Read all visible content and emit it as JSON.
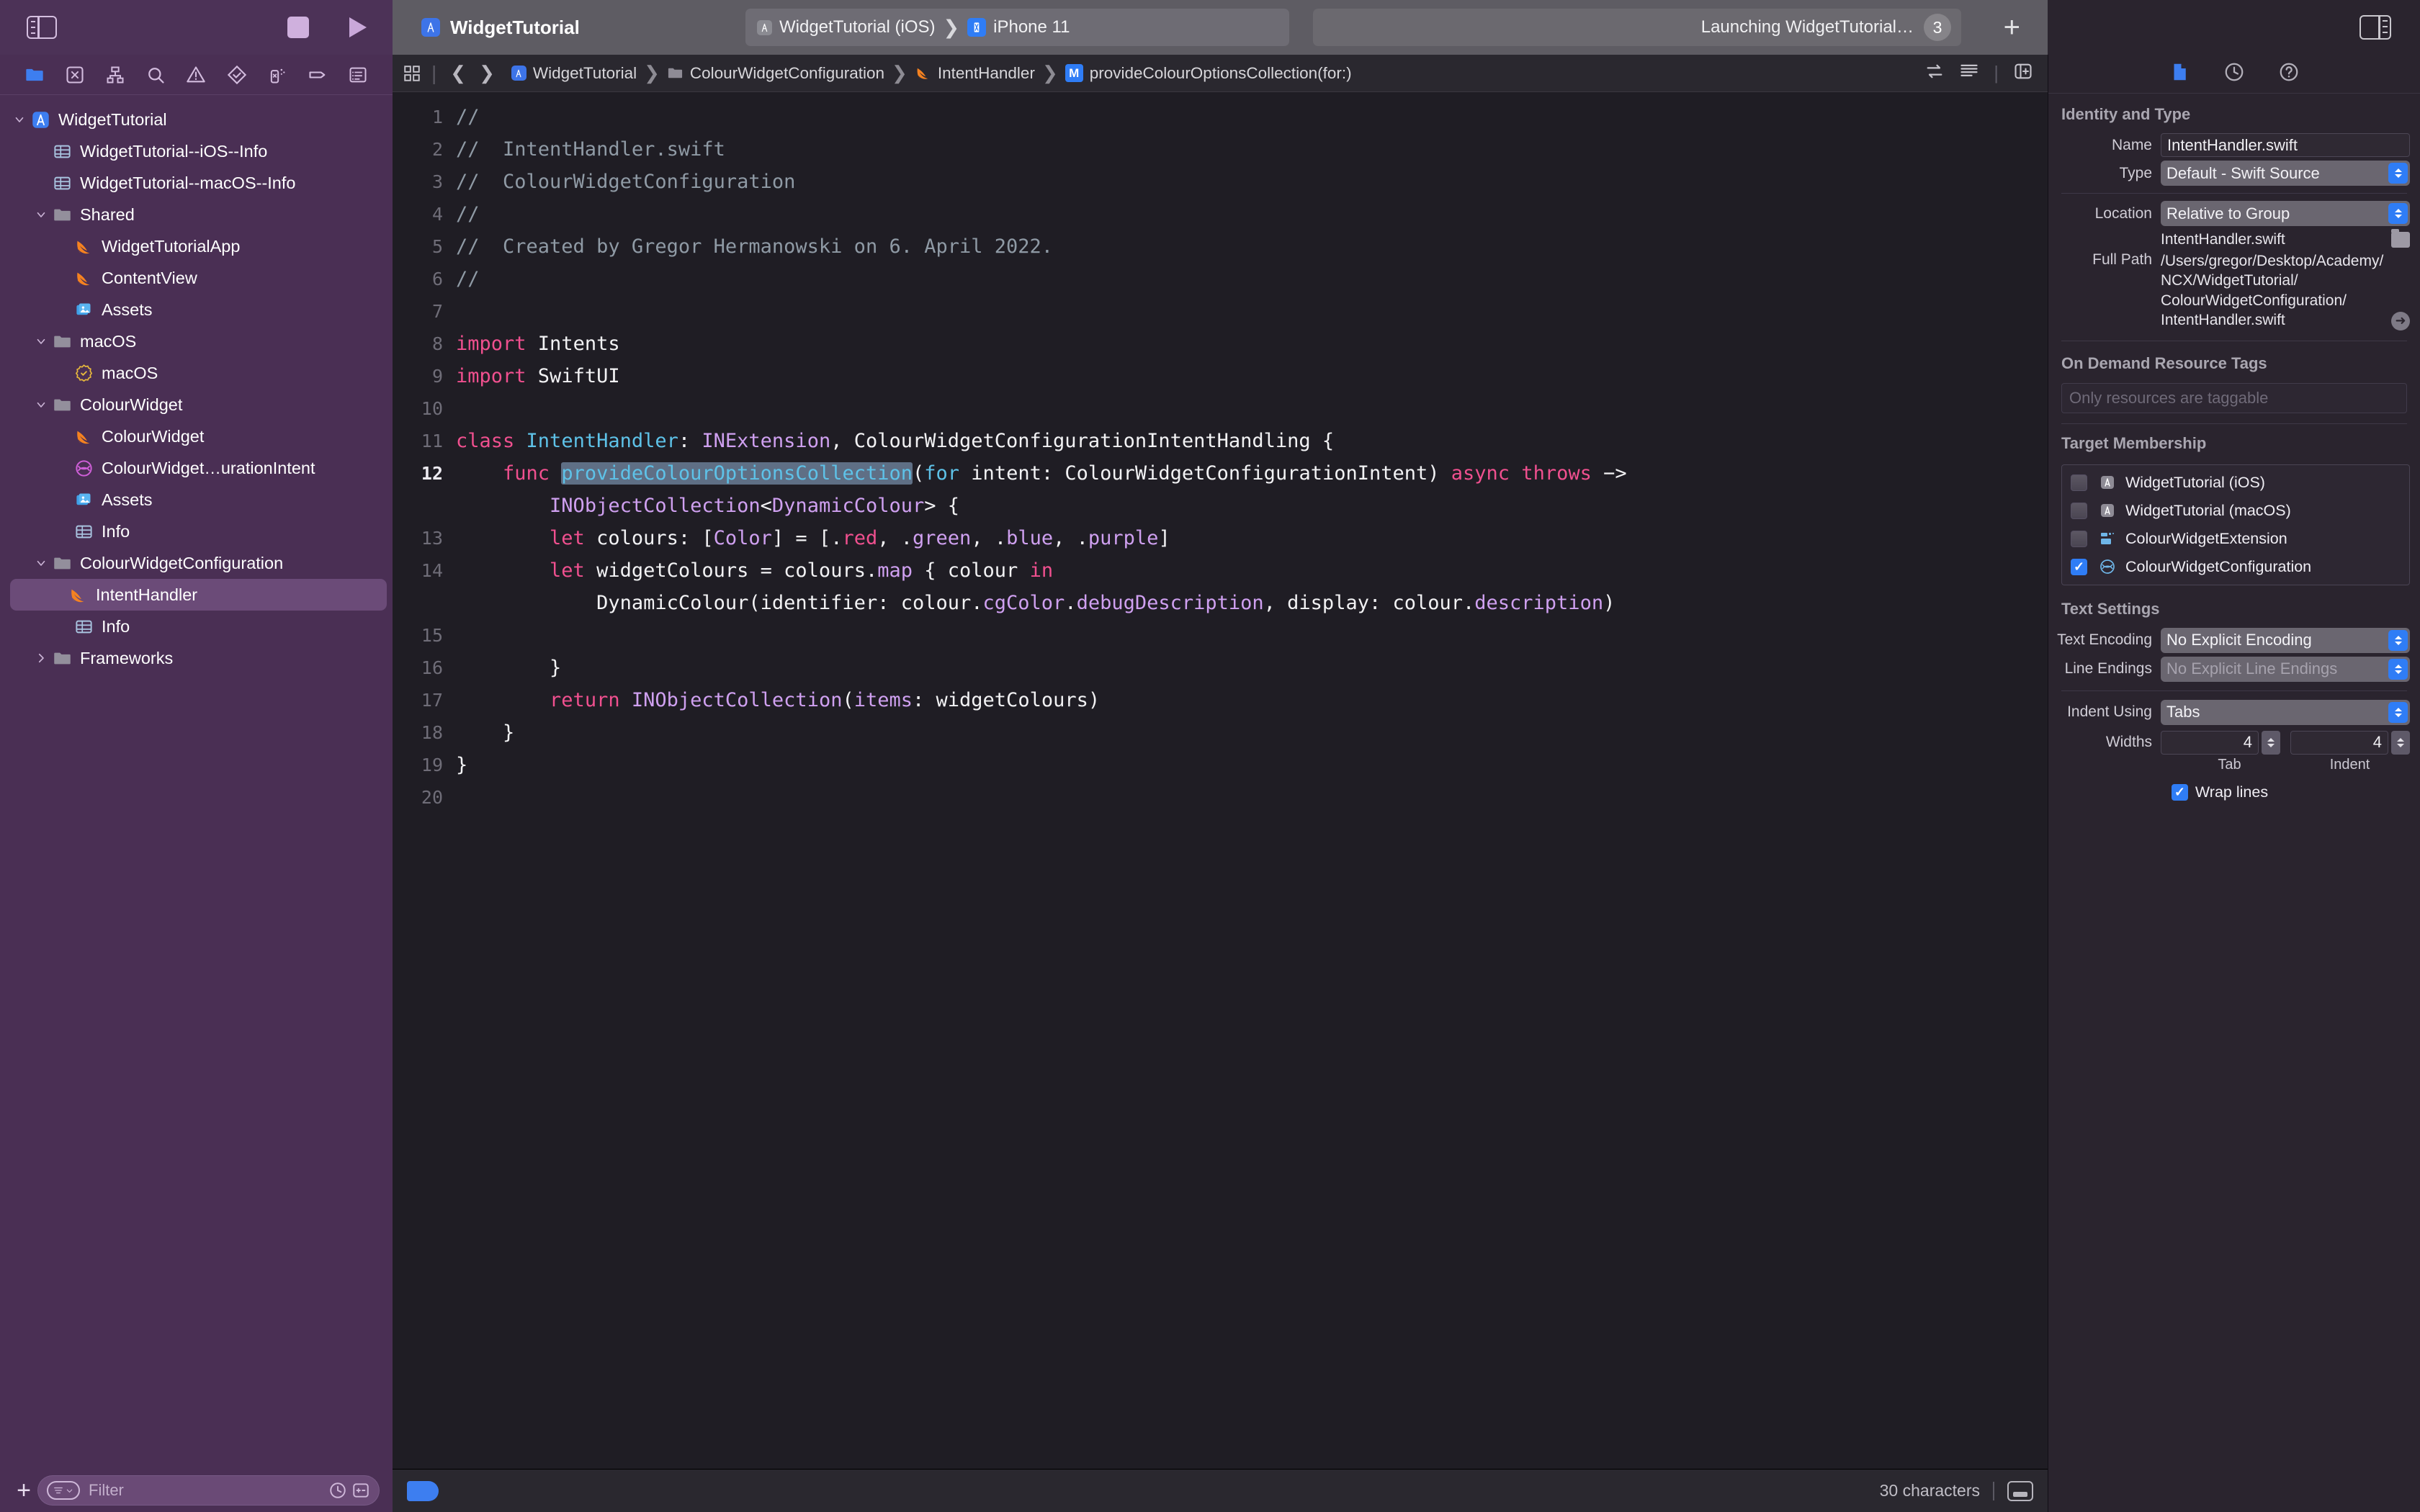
{
  "toolbar": {
    "project_title": "WidgetTutorial",
    "scheme_name": "WidgetTutorial (iOS)",
    "device_name": "iPhone 11",
    "status_text": "Launching WidgetTutorial…",
    "status_badge": "3",
    "add_label": "+"
  },
  "navigator": {
    "icons": [
      "folder-icon",
      "source-control-icon",
      "symbol-hierarchy-icon",
      "search-icon",
      "warning-icon",
      "test-diamond-icon",
      "debug-spray-icon",
      "breakpoint-tag-icon",
      "report-list-icon"
    ],
    "tree": [
      {
        "label": "WidgetTutorial",
        "indent": 0,
        "icon": "app-icon",
        "disclosure": "open",
        "selected": false
      },
      {
        "label": "WidgetTutorial--iOS--Info",
        "indent": 1,
        "icon": "plist-icon",
        "disclosure": "none",
        "selected": false
      },
      {
        "label": "WidgetTutorial--macOS--Info",
        "indent": 1,
        "icon": "plist-icon",
        "disclosure": "none",
        "selected": false
      },
      {
        "label": "Shared",
        "indent": 1,
        "icon": "folder-icon",
        "disclosure": "open",
        "selected": false
      },
      {
        "label": "WidgetTutorialApp",
        "indent": 2,
        "icon": "swift-icon",
        "disclosure": "none",
        "selected": false
      },
      {
        "label": "ContentView",
        "indent": 2,
        "icon": "swift-icon",
        "disclosure": "none",
        "selected": false
      },
      {
        "label": "Assets",
        "indent": 2,
        "icon": "assets-icon",
        "disclosure": "none",
        "selected": false
      },
      {
        "label": "macOS",
        "indent": 1,
        "icon": "folder-icon",
        "disclosure": "open",
        "selected": false
      },
      {
        "label": "macOS",
        "indent": 2,
        "icon": "entitlements-icon",
        "disclosure": "none",
        "selected": false
      },
      {
        "label": "ColourWidget",
        "indent": 1,
        "icon": "folder-icon",
        "disclosure": "open",
        "selected": false
      },
      {
        "label": "ColourWidget",
        "indent": 2,
        "icon": "swift-icon",
        "disclosure": "none",
        "selected": false
      },
      {
        "label": "ColourWidget…urationIntent",
        "indent": 2,
        "icon": "intent-icon",
        "disclosure": "none",
        "selected": false
      },
      {
        "label": "Assets",
        "indent": 2,
        "icon": "assets-icon",
        "disclosure": "none",
        "selected": false
      },
      {
        "label": "Info",
        "indent": 2,
        "icon": "plist-icon",
        "disclosure": "none",
        "selected": false
      },
      {
        "label": "ColourWidgetConfiguration",
        "indent": 1,
        "icon": "folder-icon",
        "disclosure": "open",
        "selected": false
      },
      {
        "label": "IntentHandler",
        "indent": 2,
        "icon": "swift-icon",
        "disclosure": "none",
        "selected": true
      },
      {
        "label": "Info",
        "indent": 2,
        "icon": "plist-icon",
        "disclosure": "none",
        "selected": false
      },
      {
        "label": "Frameworks",
        "indent": 1,
        "icon": "folder-icon",
        "disclosure": "closed",
        "selected": false
      }
    ],
    "filter_placeholder": "Filter",
    "add_label": "+"
  },
  "breadcrumb": [
    {
      "label": "WidgetTutorial",
      "icon": "app-icon"
    },
    {
      "label": "ColourWidgetConfiguration",
      "icon": "folder-icon"
    },
    {
      "label": "IntentHandler",
      "icon": "swift-icon"
    },
    {
      "label": "provideColourOptionsCollection(for:)",
      "icon": "method-badge"
    }
  ],
  "editor": {
    "char_count": "30 characters",
    "lines": [
      {
        "n": "1",
        "tokens": [
          {
            "t": "//",
            "c": "cmt"
          }
        ]
      },
      {
        "n": "2",
        "tokens": [
          {
            "t": "//  IntentHandler.swift",
            "c": "cmt"
          }
        ]
      },
      {
        "n": "3",
        "tokens": [
          {
            "t": "//  ColourWidgetConfiguration",
            "c": "cmt"
          }
        ]
      },
      {
        "n": "4",
        "tokens": [
          {
            "t": "//",
            "c": "cmt"
          }
        ]
      },
      {
        "n": "5",
        "tokens": [
          {
            "t": "//  Created by Gregor Hermanowski on 6. April 2022.",
            "c": "cmt"
          }
        ]
      },
      {
        "n": "6",
        "tokens": [
          {
            "t": "//",
            "c": "cmt"
          }
        ]
      },
      {
        "n": "7",
        "tokens": []
      },
      {
        "n": "8",
        "tokens": [
          {
            "t": "import",
            "c": "kw"
          },
          {
            "t": " Intents",
            "c": "pln"
          }
        ]
      },
      {
        "n": "9",
        "tokens": [
          {
            "t": "import",
            "c": "kw"
          },
          {
            "t": " SwiftUI",
            "c": "pln"
          }
        ]
      },
      {
        "n": "10",
        "tokens": []
      },
      {
        "n": "11",
        "tokens": [
          {
            "t": "class",
            "c": "kw"
          },
          {
            "t": " ",
            "c": "pln"
          },
          {
            "t": "IntentHandler",
            "c": "typ"
          },
          {
            "t": ": ",
            "c": "pln"
          },
          {
            "t": "INExtension",
            "c": "prp"
          },
          {
            "t": ", ColourWidgetConfigurationIntentHandling {",
            "c": "pln"
          }
        ]
      },
      {
        "n": "12",
        "current": true,
        "tokens": [
          {
            "t": "    ",
            "c": "pln"
          },
          {
            "t": "func",
            "c": "kw"
          },
          {
            "t": " ",
            "c": "pln"
          },
          {
            "t": "provideColourOptionsCollection",
            "c": "typ",
            "sel": true
          },
          {
            "t": "(",
            "c": "pln"
          },
          {
            "t": "for",
            "c": "typ"
          },
          {
            "t": " intent: ColourWidgetConfigurationIntent) ",
            "c": "pln"
          },
          {
            "t": "async",
            "c": "kw"
          },
          {
            "t": " ",
            "c": "pln"
          },
          {
            "t": "throws",
            "c": "kw"
          },
          {
            "t": " −>",
            "c": "pln"
          }
        ]
      },
      {
        "n": "",
        "tokens": [
          {
            "t": "        ",
            "c": "pln"
          },
          {
            "t": "INObjectCollection",
            "c": "prp"
          },
          {
            "t": "<",
            "c": "pln"
          },
          {
            "t": "DynamicColour",
            "c": "prp"
          },
          {
            "t": "> {",
            "c": "pln"
          }
        ]
      },
      {
        "n": "13",
        "tokens": [
          {
            "t": "        ",
            "c": "pln"
          },
          {
            "t": "let",
            "c": "kw"
          },
          {
            "t": " colours: [",
            "c": "pln"
          },
          {
            "t": "Color",
            "c": "prp"
          },
          {
            "t": "] = [.",
            "c": "pln"
          },
          {
            "t": "red",
            "c": "kw"
          },
          {
            "t": ", .",
            "c": "pln"
          },
          {
            "t": "green",
            "c": "prp"
          },
          {
            "t": ", .",
            "c": "pln"
          },
          {
            "t": "blue",
            "c": "prp"
          },
          {
            "t": ", .",
            "c": "pln"
          },
          {
            "t": "purple",
            "c": "prp"
          },
          {
            "t": "]",
            "c": "pln"
          }
        ]
      },
      {
        "n": "14",
        "tokens": [
          {
            "t": "        ",
            "c": "pln"
          },
          {
            "t": "let",
            "c": "kw"
          },
          {
            "t": " widgetColours = colours.",
            "c": "pln"
          },
          {
            "t": "map",
            "c": "prp"
          },
          {
            "t": " { colour ",
            "c": "pln"
          },
          {
            "t": "in",
            "c": "kw"
          }
        ]
      },
      {
        "n": "",
        "tokens": [
          {
            "t": "            DynamicColour(identifier: colour.",
            "c": "pln"
          },
          {
            "t": "cgColor",
            "c": "prp"
          },
          {
            "t": ".",
            "c": "pln"
          },
          {
            "t": "debugDescription",
            "c": "prp"
          },
          {
            "t": ", display: colour.",
            "c": "pln"
          },
          {
            "t": "description",
            "c": "prp"
          },
          {
            "t": ")",
            "c": "pln"
          }
        ]
      },
      {
        "n": "15",
        "tokens": []
      },
      {
        "n": "16",
        "tokens": [
          {
            "t": "        }",
            "c": "pln"
          }
        ]
      },
      {
        "n": "17",
        "tokens": [
          {
            "t": "        ",
            "c": "pln"
          },
          {
            "t": "return",
            "c": "kw"
          },
          {
            "t": " ",
            "c": "pln"
          },
          {
            "t": "INObjectCollection",
            "c": "prp"
          },
          {
            "t": "(",
            "c": "pln"
          },
          {
            "t": "items",
            "c": "prp"
          },
          {
            "t": ": widgetColours)",
            "c": "pln"
          }
        ]
      },
      {
        "n": "18",
        "tokens": [
          {
            "t": "    }",
            "c": "pln"
          }
        ]
      },
      {
        "n": "19",
        "tokens": [
          {
            "t": "}",
            "c": "pln"
          }
        ]
      },
      {
        "n": "20",
        "tokens": []
      }
    ]
  },
  "inspector": {
    "tabs": [
      "file-inspector-icon",
      "history-inspector-icon",
      "quick-help-icon"
    ],
    "identity_title": "Identity and Type",
    "name_label": "Name",
    "name_value": "IntentHandler.swift",
    "type_label": "Type",
    "type_value": "Default - Swift Source",
    "location_label": "Location",
    "location_value": "Relative to Group",
    "location_filename": "IntentHandler.swift",
    "full_path_label": "Full Path",
    "full_path_value": "/Users/gregor/Desktop/Academy/NCX/WidgetTutorial/ColourWidgetConfiguration/IntentHandler.swift",
    "odr_title": "On Demand Resource Tags",
    "odr_placeholder": "Only resources are taggable",
    "target_title": "Target Membership",
    "targets": [
      {
        "label": "WidgetTutorial (iOS)",
        "checked": false,
        "icon": "app-target-icon"
      },
      {
        "label": "WidgetTutorial (macOS)",
        "checked": false,
        "icon": "app-target-icon"
      },
      {
        "label": "ColourWidgetExtension",
        "checked": false,
        "icon": "extension-target-icon"
      },
      {
        "label": "ColourWidgetConfiguration",
        "checked": true,
        "icon": "intent-target-icon"
      }
    ],
    "text_title": "Text Settings",
    "encoding_label": "Text Encoding",
    "encoding_value": "No Explicit Encoding",
    "endings_label": "Line Endings",
    "endings_value": "No Explicit Line Endings",
    "indent_label": "Indent Using",
    "indent_value": "Tabs",
    "widths_label": "Widths",
    "tab_width": "4",
    "indent_width": "4",
    "tab_caption": "Tab",
    "indent_caption": "Indent",
    "wrap_label": "Wrap lines",
    "wrap_checked": true
  },
  "colors": {
    "accent_blue": "#2f7df6",
    "navigator_purple": "#4a2f54",
    "editor_bg": "#1f1d24",
    "keyword_pink": "#f0508f",
    "type_cyan": "#5ec2e8",
    "property_purple": "#cfa0f0",
    "comment_gray": "#8f9aa5",
    "swift_orange": "#f58220"
  }
}
